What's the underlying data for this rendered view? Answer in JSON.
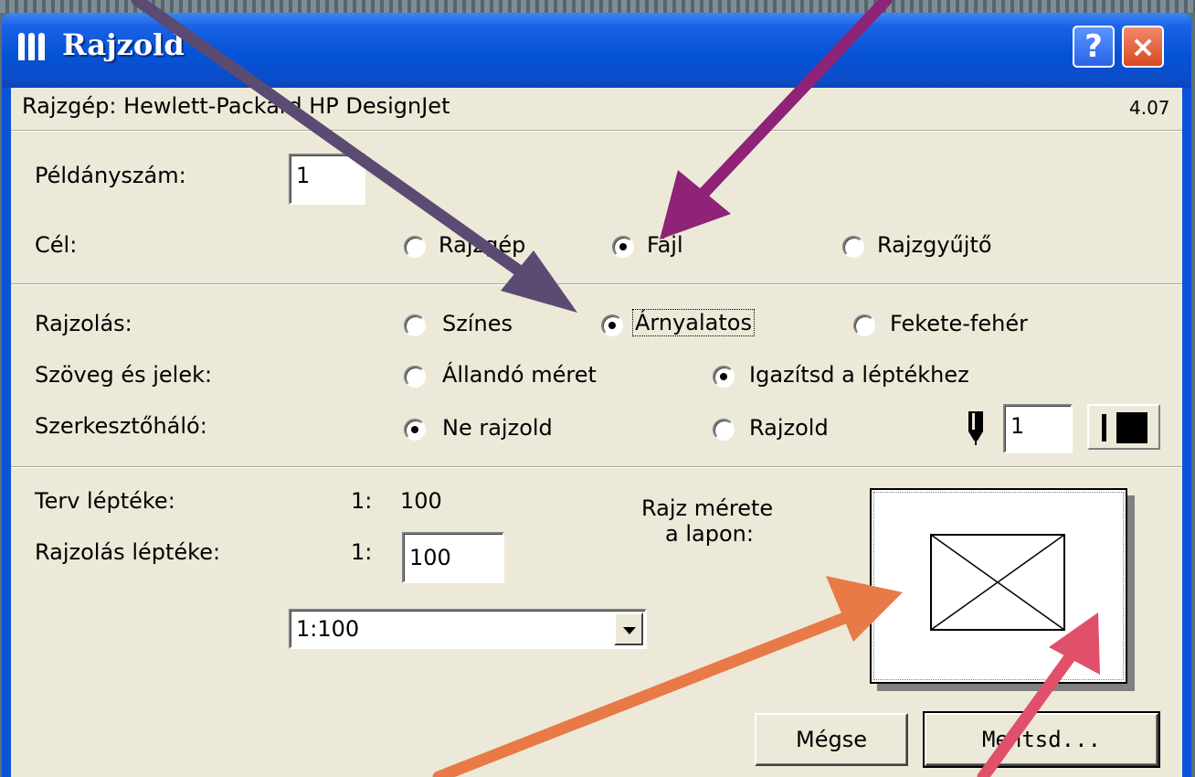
{
  "window": {
    "title": "Rajzold",
    "help_label": "?",
    "close_label": "×"
  },
  "header": {
    "plotter": "Rajzgép: Hewlett-Packard HP DesignJet",
    "version": "4.07"
  },
  "copies": {
    "label": "Példányszám:",
    "value": "1"
  },
  "target": {
    "label": "Cél:",
    "options": [
      {
        "label": "Rajzgép",
        "checked": false
      },
      {
        "label": "Fájl",
        "checked": true
      },
      {
        "label": "Rajzgyűjtő",
        "checked": false
      }
    ]
  },
  "plotting": {
    "label": "Rajzolás:",
    "options": [
      {
        "label": "Színes",
        "checked": false
      },
      {
        "label": "Árnyalatos",
        "checked": true
      },
      {
        "label": "Fekete-fehér",
        "checked": false
      }
    ]
  },
  "text_marks": {
    "label": "Szöveg és jelek:",
    "options": [
      {
        "label": "Állandó méret",
        "checked": false
      },
      {
        "label": "Igazítsd a léptékhez",
        "checked": true
      }
    ]
  },
  "grid": {
    "label": "Szerkesztőháló:",
    "options": [
      {
        "label": "Ne rajzold",
        "checked": true
      },
      {
        "label": "Rajzold",
        "checked": false
      }
    ],
    "pen_value": "1"
  },
  "scale": {
    "plan_label": "Terv léptéke:",
    "plan_prefix": "1:",
    "plan_value": "100",
    "plot_label": "Rajzolás léptéke:",
    "plot_prefix": "1:",
    "plot_value": "100",
    "preset": "1:100"
  },
  "drawing_size": {
    "line1": "Rajz mérete",
    "line2": "a lapon:"
  },
  "buttons": {
    "cancel": "Mégse",
    "save": "Mentsd..."
  },
  "colors": {
    "arrow_slate": "#5b4a72",
    "arrow_magenta": "#8e2377",
    "arrow_orange": "#e87a48",
    "arrow_red": "#e0506a"
  }
}
